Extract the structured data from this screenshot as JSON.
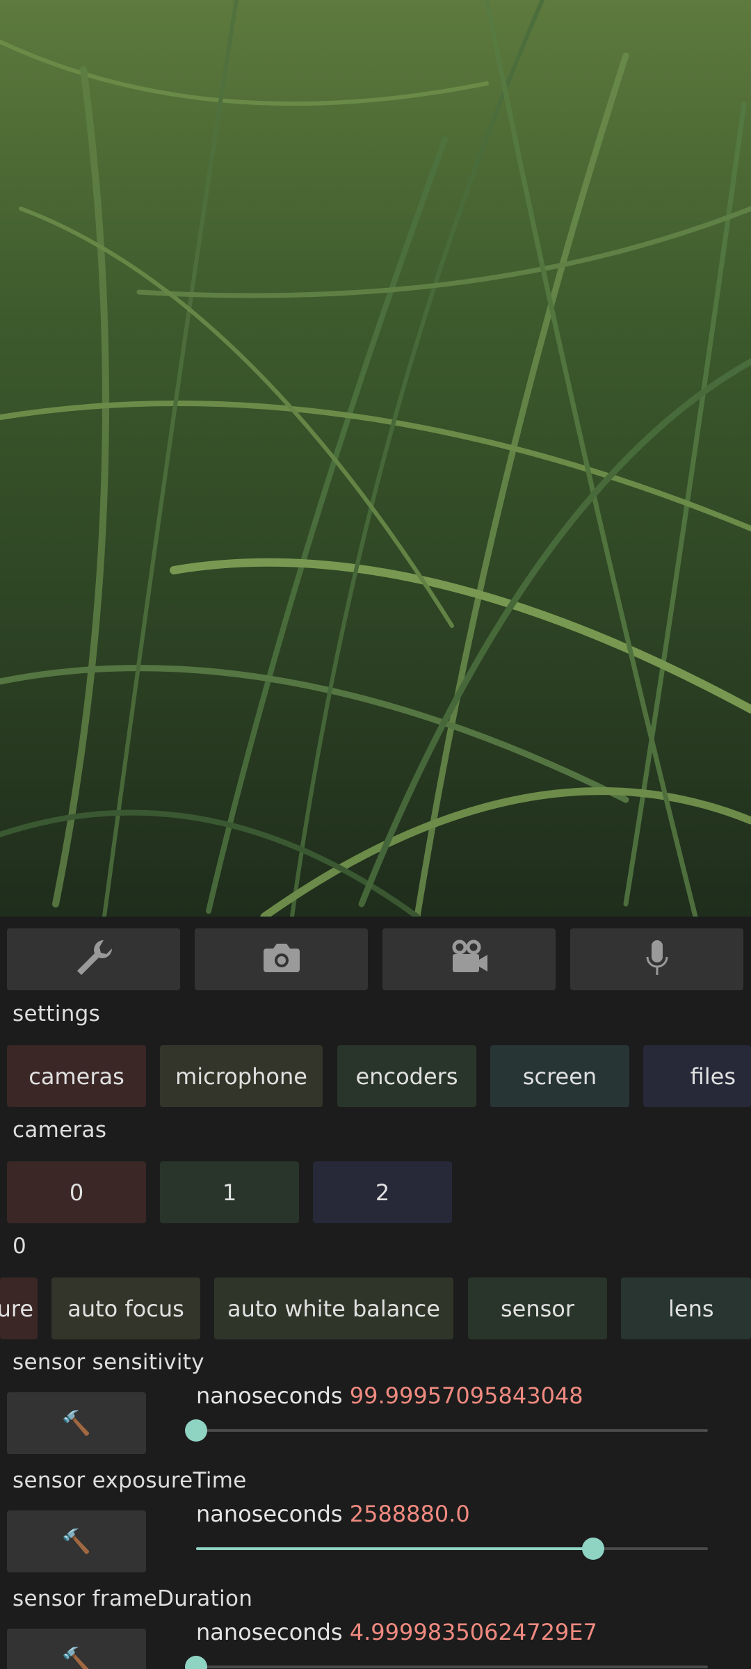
{
  "colors": {
    "accent": "#8fd3c3",
    "value_text": "#f08a80",
    "button_bg": "#333333",
    "background": "#1c1c1c"
  },
  "toolbar": {
    "buttons": [
      {
        "icon": "wrench-icon"
      },
      {
        "icon": "camera-icon"
      },
      {
        "icon": "video-camera-icon"
      },
      {
        "icon": "microphone-icon"
      }
    ]
  },
  "settings": {
    "label": "settings",
    "tabs": [
      "cameras",
      "microphone",
      "encoders",
      "screen",
      "files"
    ]
  },
  "cameras": {
    "label": "cameras",
    "items": [
      "0",
      "1",
      "2"
    ]
  },
  "camera0": {
    "label": "0",
    "tabs": [
      "ure",
      "auto focus",
      "auto white balance",
      "sensor",
      "lens"
    ]
  },
  "controls": [
    {
      "label": "sensor sensitivity",
      "unit": "nanoseconds",
      "value": "99.99957095843048",
      "level": 0.0
    },
    {
      "label": "sensor exposureTime",
      "unit": "nanoseconds",
      "value": "2588880.0",
      "level": 0.776
    },
    {
      "label": "sensor frameDuration",
      "unit": "nanoseconds",
      "value": "4.99998350624729E7",
      "level": 0.0
    }
  ],
  "tool_icon": "hammer-icon",
  "tool_glyph": "🔨"
}
